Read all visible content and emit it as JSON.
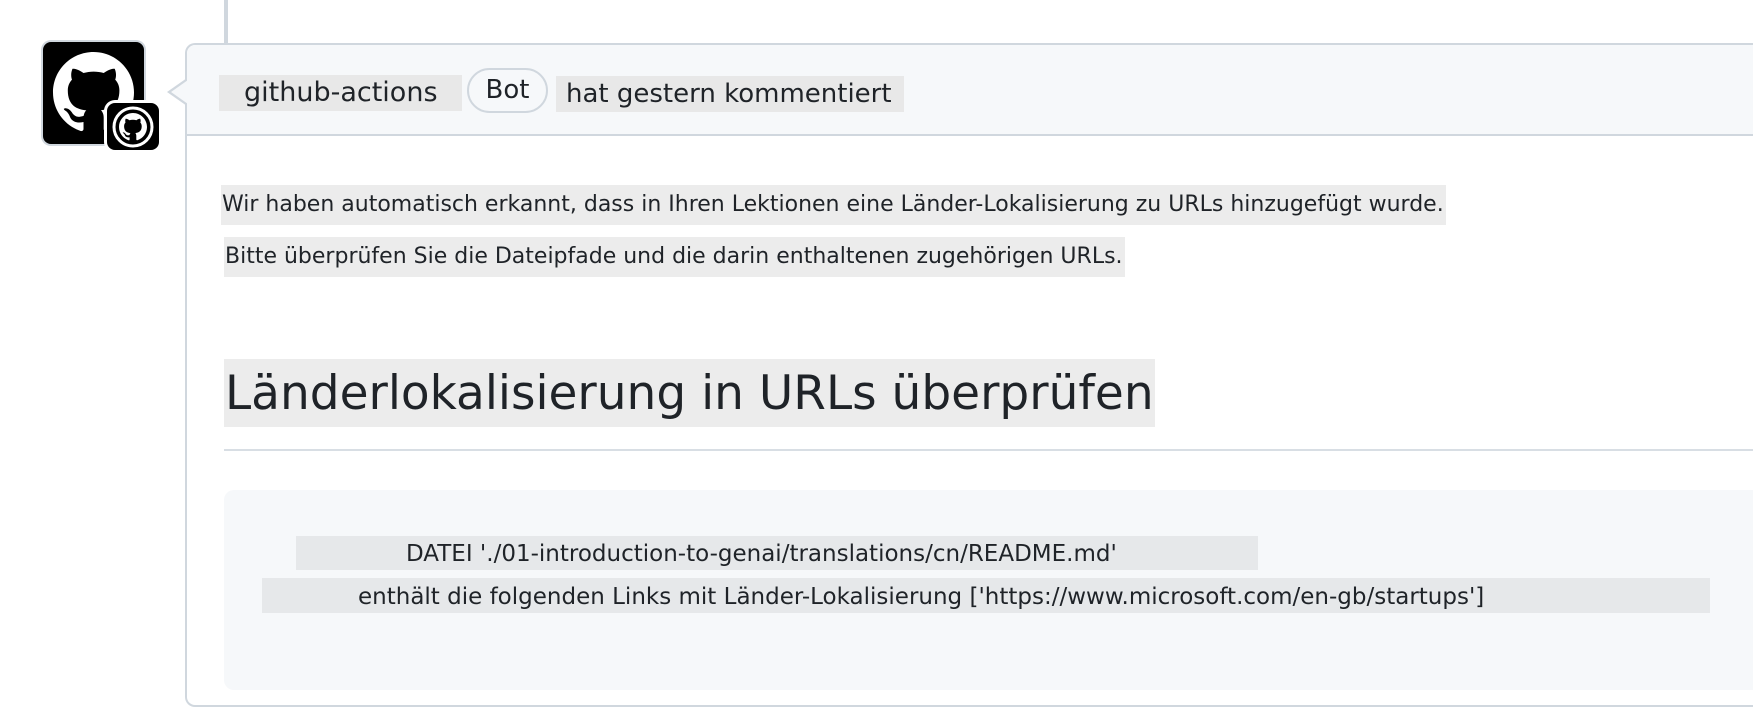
{
  "comment": {
    "author": "github-actions",
    "badge": "Bot",
    "action": "hat gestern kommentiert",
    "avatar_icon": "github-octocat-icon",
    "badge_icon": "github-octocat-icon"
  },
  "body": {
    "paragraph_1": "Wir haben automatisch erkannt, dass in Ihren Lektionen eine Länder-Lokalisierung zu URLs hinzugefügt wurde.",
    "paragraph_2": "Bitte überprüfen Sie die Dateipfade und die darin enthaltenen zugehörigen URLs.",
    "heading": "Länderlokalisierung in URLs überprüfen",
    "code_lines": [
      "DATEI './01-introduction-to-genai/translations/cn/README.md'",
      "enthält die folgenden Links mit Länder-Lokalisierung ['https://www.microsoft.com/en-gb/startups']"
    ]
  }
}
